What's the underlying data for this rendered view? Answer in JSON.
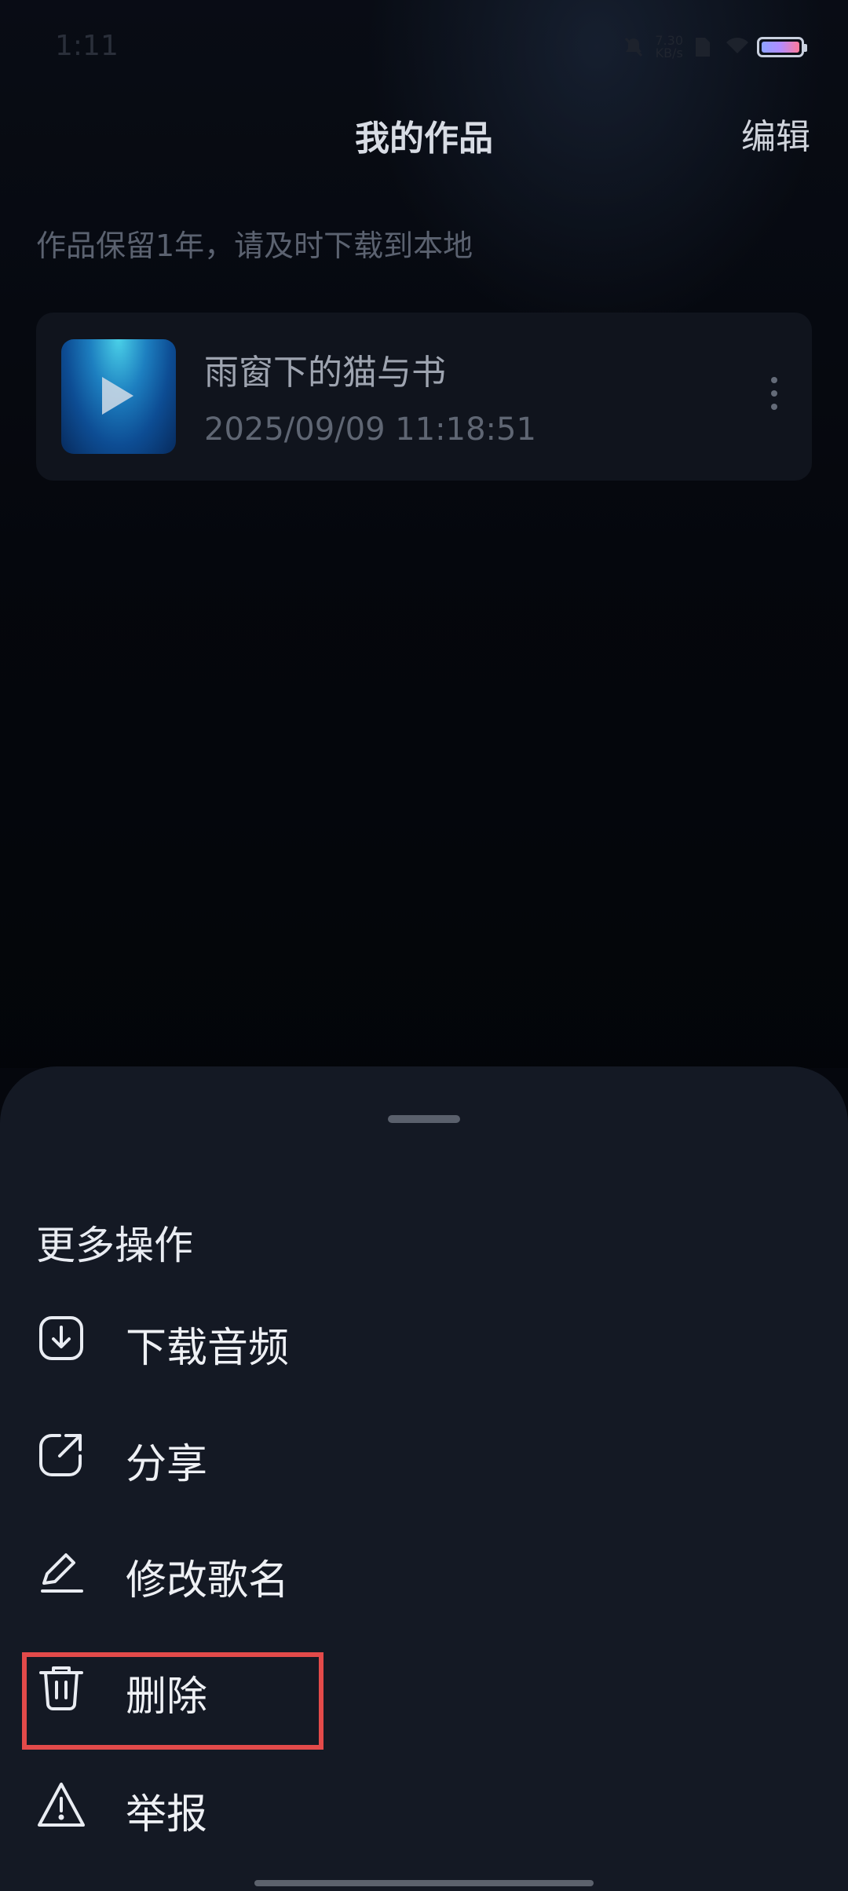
{
  "status_bar": {
    "time": "1:11",
    "speed_value": "7.30",
    "speed_unit": "KB/s",
    "icons": [
      "mute-icon",
      "sim-icon",
      "wifi-icon",
      "battery-icon"
    ],
    "battery_level": 1.0
  },
  "header": {
    "title": "我的作品",
    "edit_label": "编辑"
  },
  "notice": "作品保留1年，请及时下载到本地",
  "works": [
    {
      "title": "雨窗下的猫与书",
      "date": "2025/09/09 11:18:51"
    }
  ],
  "sheet": {
    "title": "更多操作",
    "actions": [
      {
        "label": "下载音频",
        "icon": "download-icon"
      },
      {
        "label": "分享",
        "icon": "share-icon"
      },
      {
        "label": "修改歌名",
        "icon": "edit-pen-icon"
      },
      {
        "label": "删除",
        "icon": "trash-icon"
      },
      {
        "label": "举报",
        "icon": "warning-icon"
      }
    ]
  },
  "colors": {
    "background": "#06080f",
    "sheet": "#141924",
    "highlight": "#e34a4a"
  }
}
